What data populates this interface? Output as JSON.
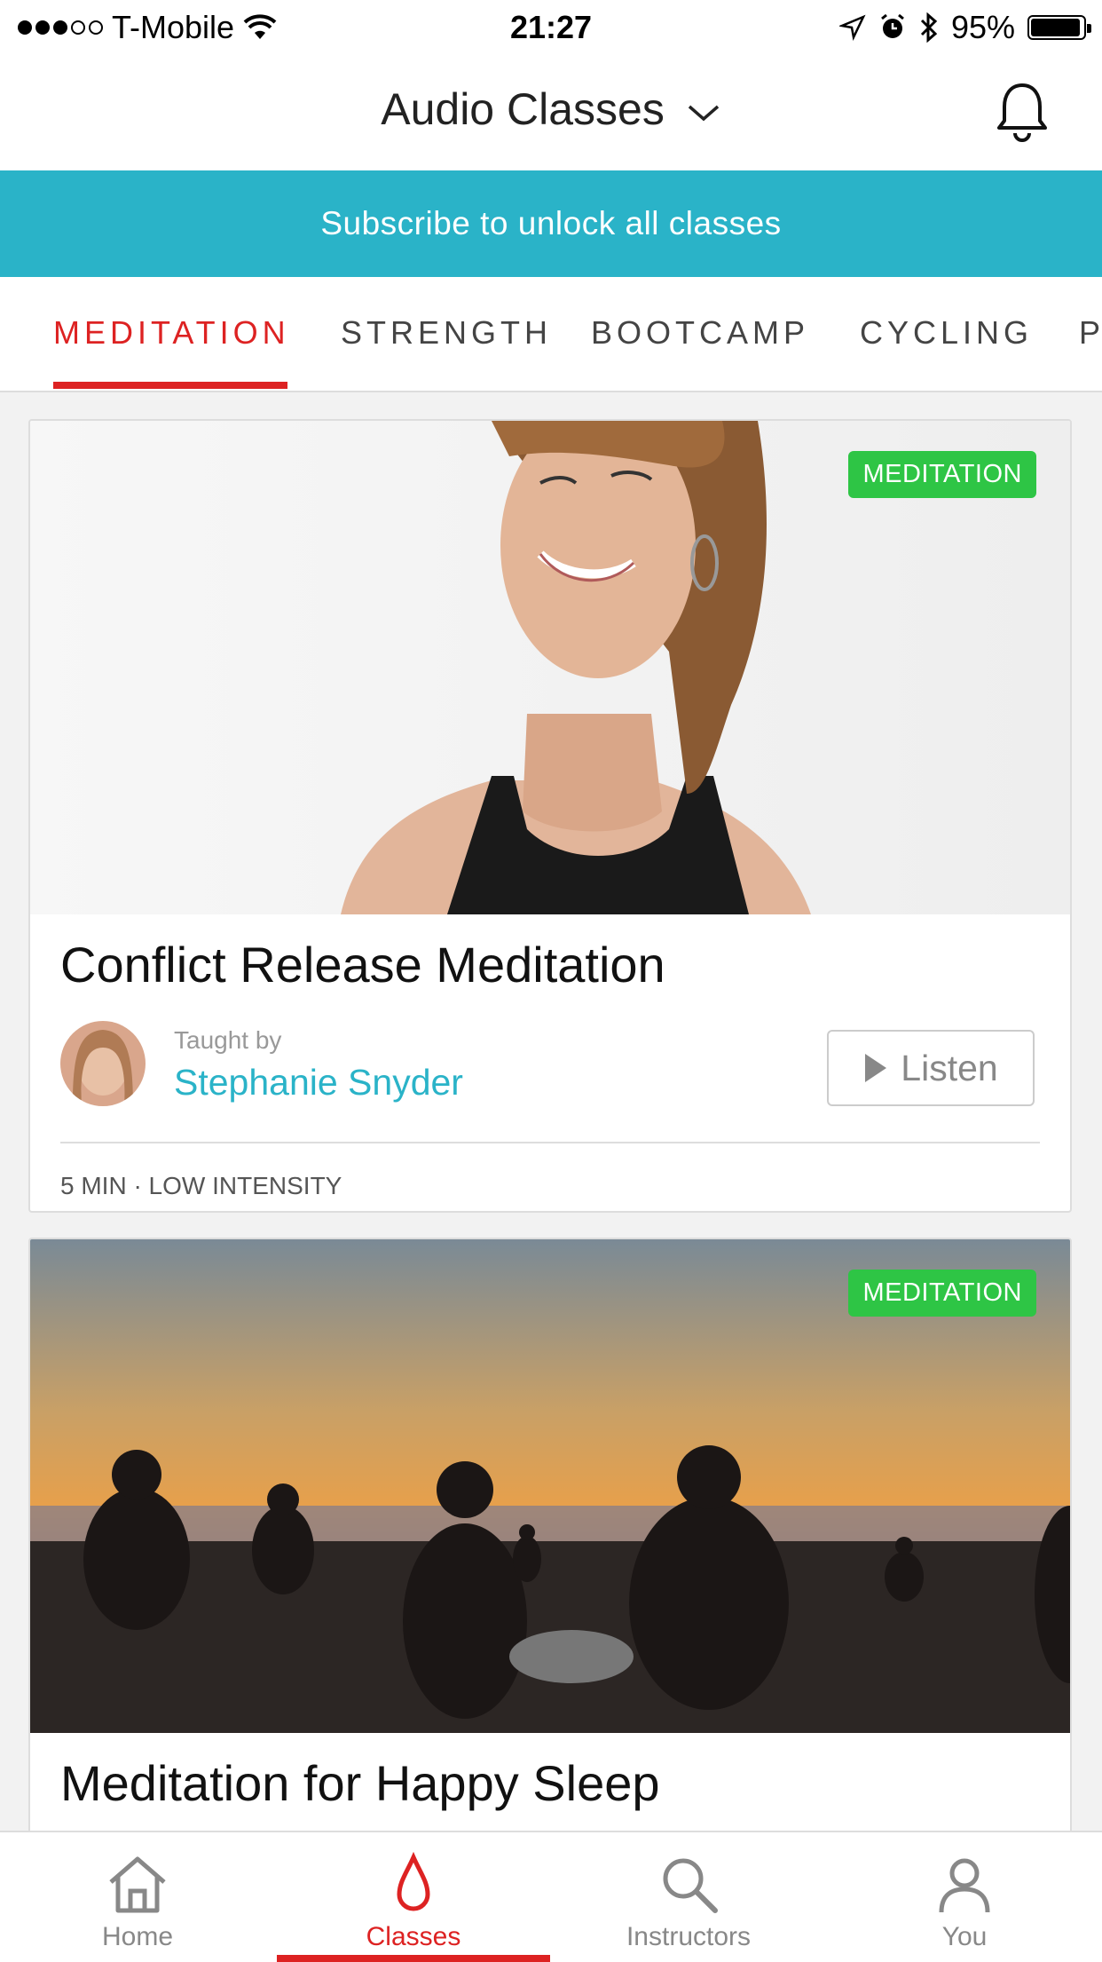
{
  "status_bar": {
    "carrier": "T-Mobile",
    "time": "21:27",
    "battery": "95%",
    "battery_level": 0.95
  },
  "header": {
    "title": "Audio Classes"
  },
  "banner": {
    "text": "Subscribe to unlock all classes"
  },
  "tabs": [
    {
      "label": "MEDITATION",
      "active": true
    },
    {
      "label": "STRENGTH",
      "active": false
    },
    {
      "label": "BOOTCAMP",
      "active": false
    },
    {
      "label": "CYCLING",
      "active": false
    },
    {
      "label": "P",
      "active": false
    }
  ],
  "cards": [
    {
      "badge": "MEDITATION",
      "title": "Conflict Release Meditation",
      "taught_by_label": "Taught by",
      "instructor": "Stephanie Snyder",
      "listen_label": "Listen",
      "meta": "5 MIN · LOW INTENSITY"
    },
    {
      "badge": "MEDITATION",
      "title": "Meditation for Happy Sleep"
    }
  ],
  "bottom_nav": [
    {
      "label": "Home",
      "icon": "home-icon"
    },
    {
      "label": "Classes",
      "icon": "drop-icon",
      "active": true
    },
    {
      "label": "Instructors",
      "icon": "search-icon"
    },
    {
      "label": "You",
      "icon": "person-icon"
    }
  ],
  "colors": {
    "accent_red": "#dd2222",
    "teal": "#2ab3c8",
    "badge_green": "#2ec545"
  }
}
